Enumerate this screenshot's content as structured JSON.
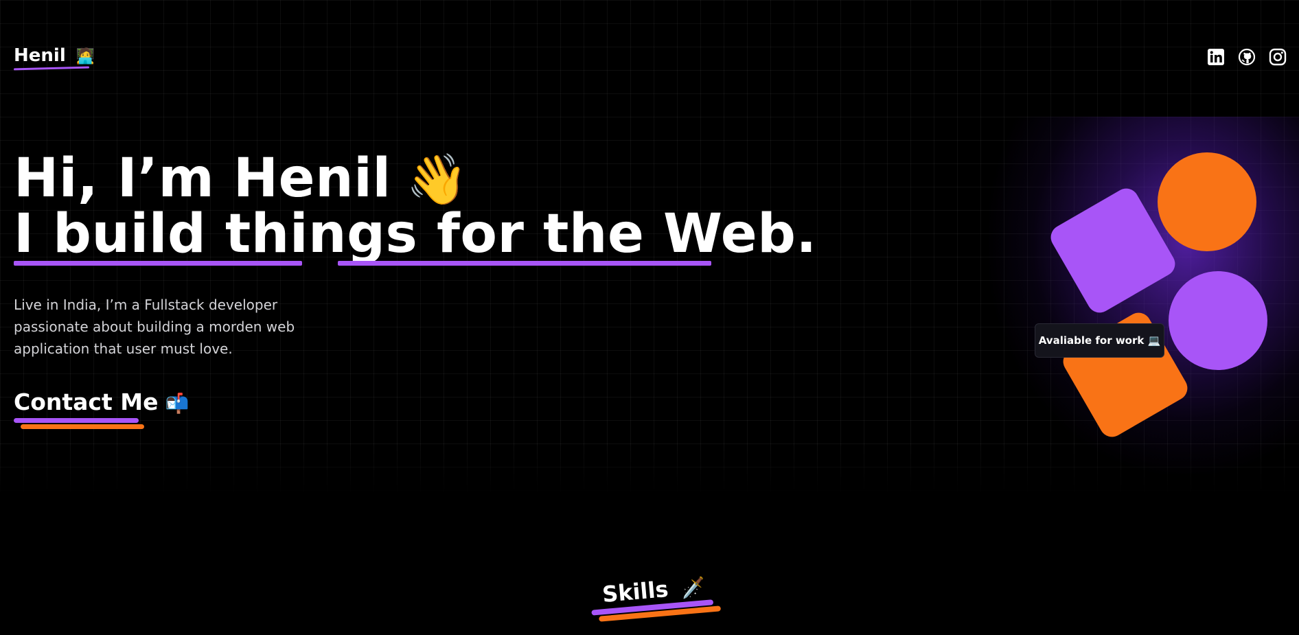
{
  "header": {
    "logo_text": "Henil",
    "logo_emoji": "🧑‍💻",
    "socials": [
      {
        "name": "linkedin-icon"
      },
      {
        "name": "github-icon"
      },
      {
        "name": "instagram-icon"
      }
    ]
  },
  "hero": {
    "greeting": "Hi, I’m Henil",
    "wave_emoji": "👋",
    "tagline": "I build things for the Web.",
    "description": "Live in India, I’m a Fullstack developer passionate about building a morden web application that user must love.",
    "cta_label": "Contact Me",
    "cta_emoji": "📬"
  },
  "badge": {
    "label": "Avaliable for work 💻"
  },
  "skills": {
    "title": "Skills",
    "emoji": "🗡️"
  },
  "colors": {
    "purple": "#a855f7",
    "orange": "#f97316",
    "background": "#000000"
  }
}
